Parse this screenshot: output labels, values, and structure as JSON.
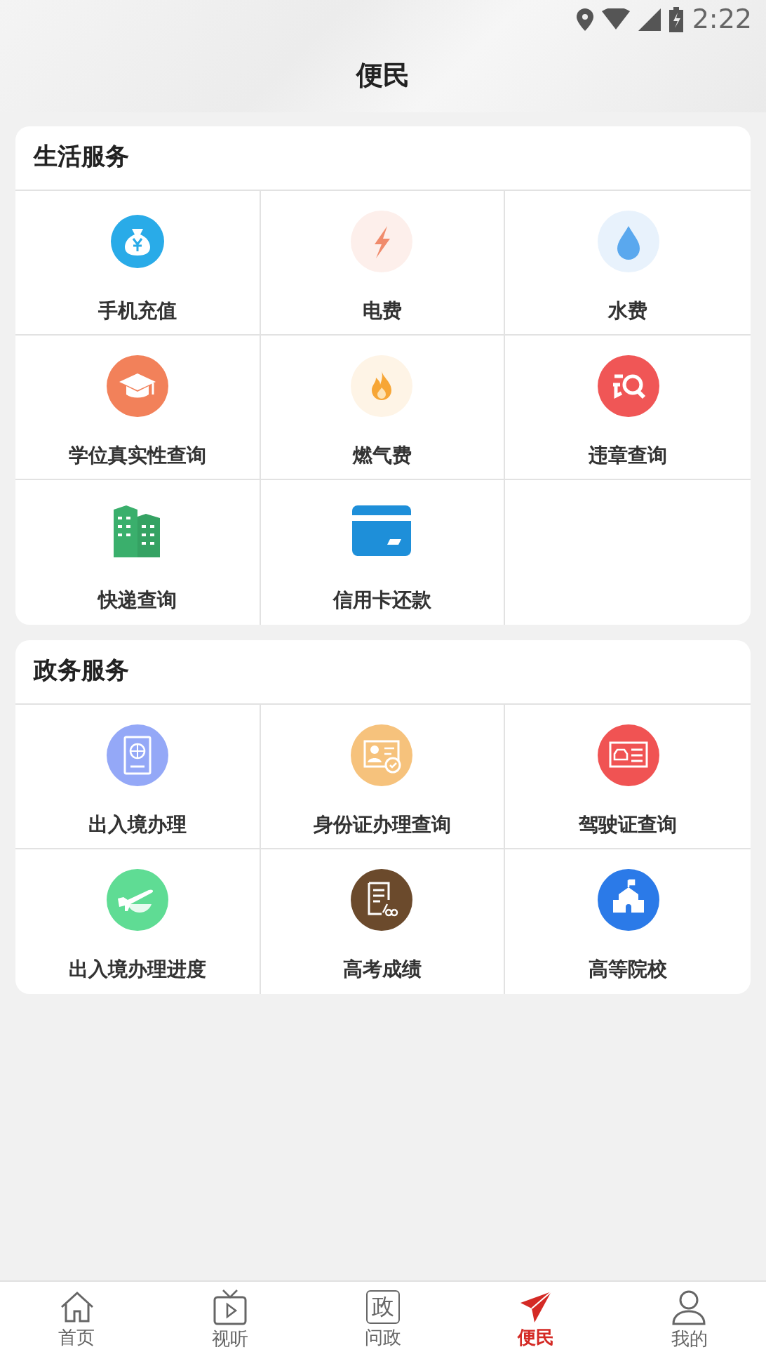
{
  "status_bar": {
    "time": "2:22"
  },
  "header": {
    "title": "便民"
  },
  "sections": [
    {
      "title": "生活服务",
      "items": [
        {
          "label": "手机充值",
          "kind": "moneybag"
        },
        {
          "label": "电费",
          "kind": "lightning"
        },
        {
          "label": "水费",
          "kind": "drop"
        },
        {
          "label": "学位真实性查询",
          "kind": "graduation"
        },
        {
          "label": "燃气费",
          "kind": "flame"
        },
        {
          "label": "违章查询",
          "kind": "violation"
        },
        {
          "label": "快递查询",
          "kind": "buildings"
        },
        {
          "label": "信用卡还款",
          "kind": "card"
        }
      ]
    },
    {
      "title": "政务服务",
      "items": [
        {
          "label": "出入境办理",
          "kind": "passport"
        },
        {
          "label": "身份证办理查询",
          "kind": "idcard"
        },
        {
          "label": "驾驶证查询",
          "kind": "license"
        },
        {
          "label": "出入境办理进度",
          "kind": "plane"
        },
        {
          "label": "高考成绩",
          "kind": "exam"
        },
        {
          "label": "高等院校",
          "kind": "school"
        }
      ]
    }
  ],
  "tab_bar": [
    {
      "label": "首页",
      "kind": "home",
      "selected": false
    },
    {
      "label": "视听",
      "kind": "tv",
      "selected": false
    },
    {
      "label": "问政",
      "kind": "glyph",
      "glyph": "政",
      "selected": false
    },
    {
      "label": "便民",
      "kind": "send",
      "selected": true
    },
    {
      "label": "我的",
      "kind": "person",
      "selected": false
    }
  ]
}
